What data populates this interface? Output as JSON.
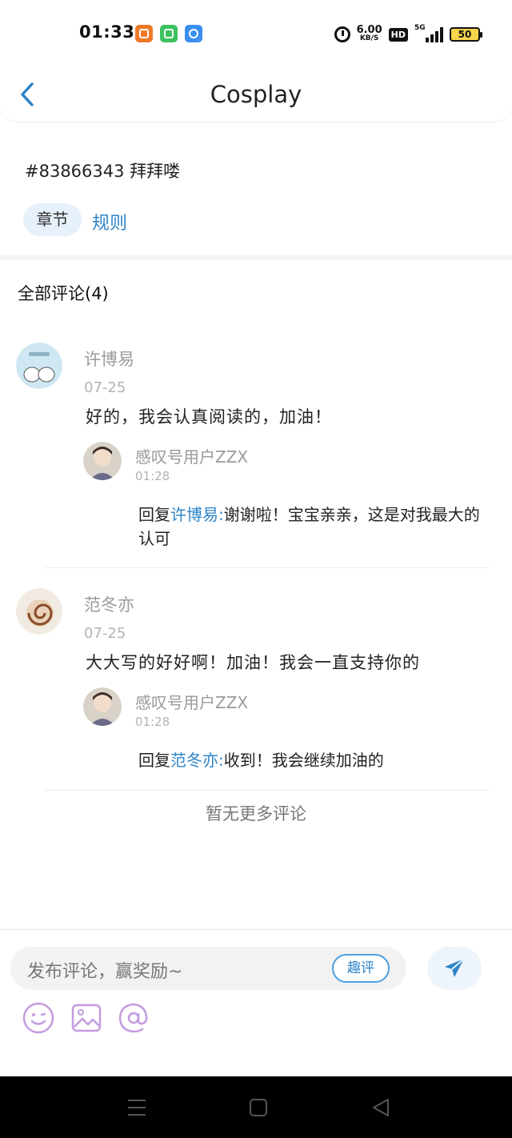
{
  "status_bar": {
    "time": "01:33",
    "net_speed_value": "6.00",
    "net_speed_unit": "KB/S",
    "hd_label": "HD",
    "network_tag": "5G",
    "battery_level": "50"
  },
  "header": {
    "title": "Cosplay",
    "back_icon": "chevron-left-icon"
  },
  "chapter": {
    "title": "#83866343 拜拜喽",
    "tag_label": "章节",
    "rules_link": "规则"
  },
  "comments": {
    "heading": "全部评论(4)",
    "items": [
      {
        "author": "许博易",
        "date": "07-25",
        "text": "好的，我会认真阅读的，加油！",
        "reply": {
          "author": "感叹号用户ZZX",
          "time": "01:28",
          "prefix": "回复",
          "mention": "许博易:",
          "text": "谢谢啦！宝宝亲亲，这是对我最大的认可"
        }
      },
      {
        "author": "范冬亦",
        "date": "07-25",
        "text": "大大写的好好啊！加油！我会一直支持你的",
        "reply": {
          "author": "感叹号用户ZZX",
          "time": "01:28",
          "prefix": "回复",
          "mention": "范冬亦:",
          "text": "收到！我会继续加油的"
        }
      }
    ],
    "no_more": "暂无更多评论"
  },
  "composer": {
    "placeholder": "发布评论，赢奖励~",
    "quping_label": "趣评",
    "send_icon": "send-icon",
    "tools": [
      "emoji-icon",
      "image-icon",
      "mention-icon"
    ]
  },
  "colors": {
    "accent": "#2d84c8",
    "tag_bg": "#e6f1fb",
    "muted_text": "#9a9a9a"
  }
}
